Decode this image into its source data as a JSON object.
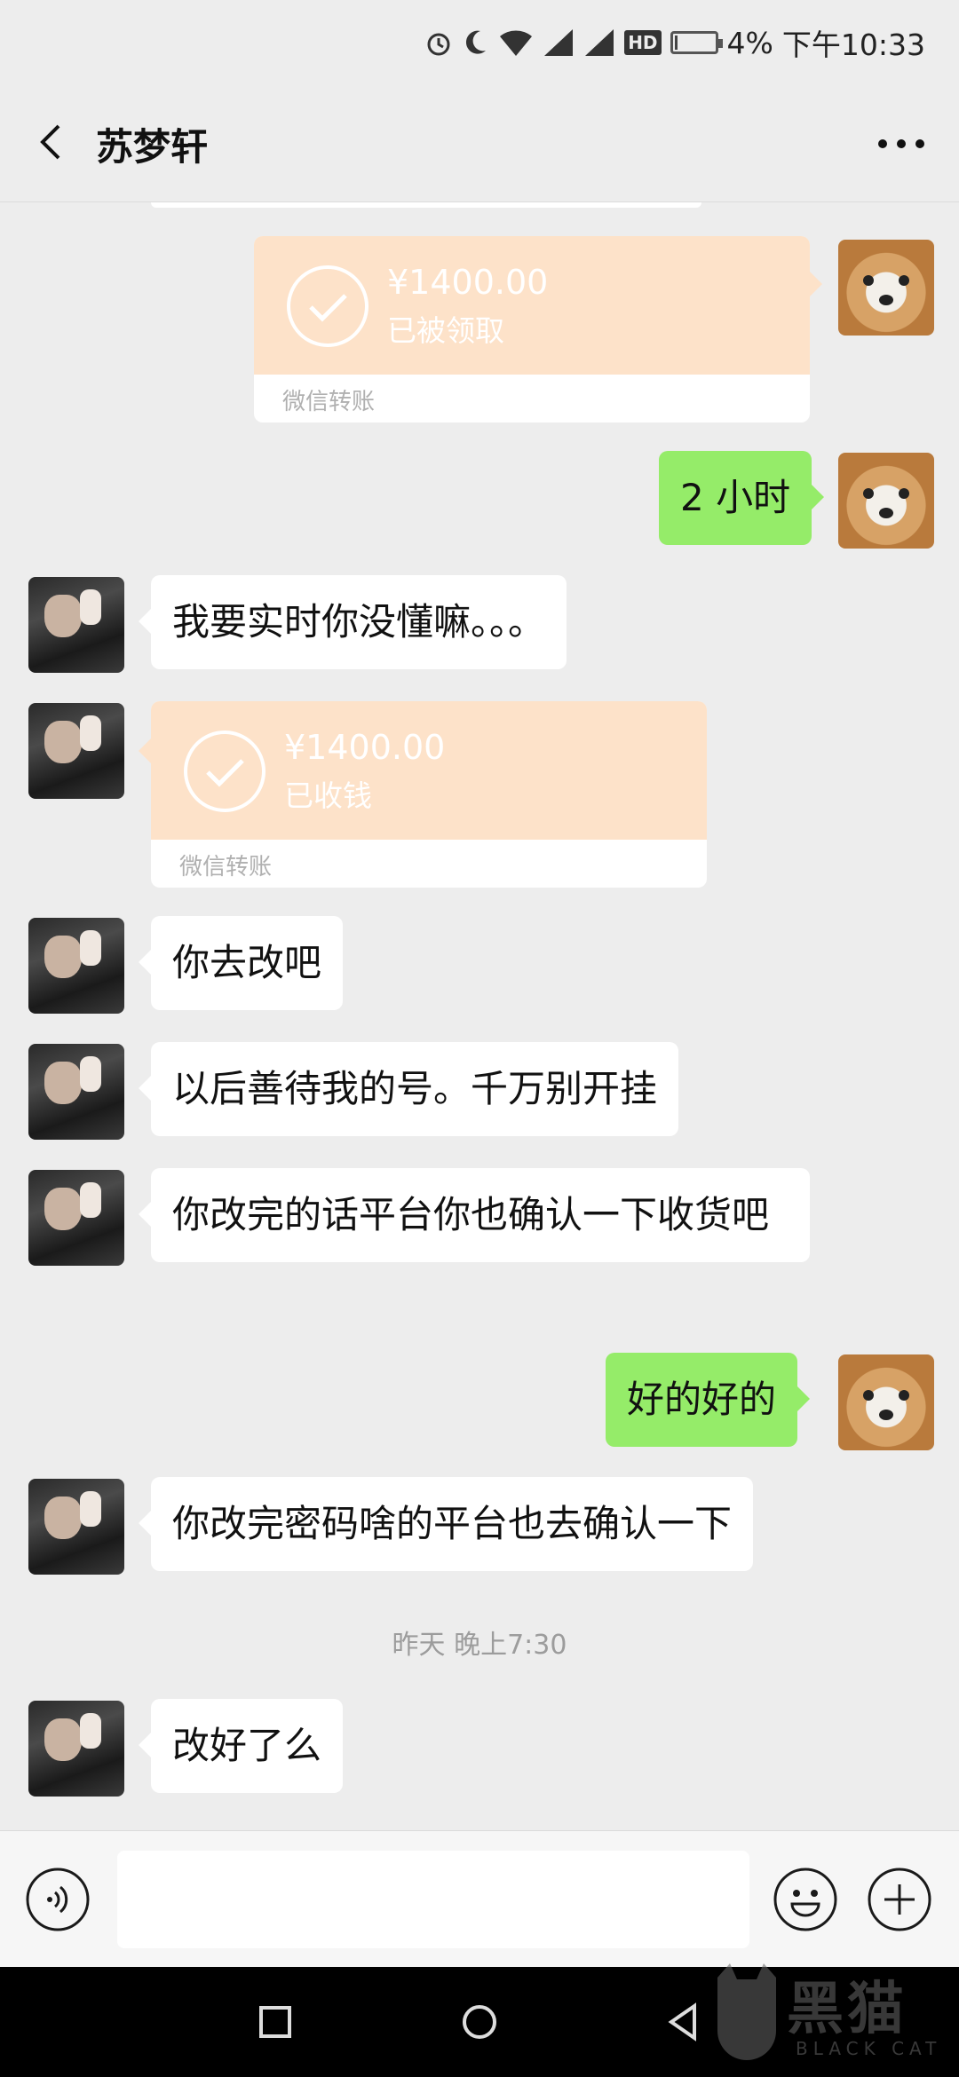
{
  "status_bar": {
    "battery_percent": "4%",
    "time": "下午10:33",
    "icons": [
      "alarm-icon",
      "moon-icon",
      "wifi-icon",
      "signal-icon",
      "signal-icon",
      "hd-icon",
      "battery-icon"
    ],
    "hd_label": "HD"
  },
  "header": {
    "title": "苏梦轩",
    "back_icon": "chevron-left-icon",
    "more_icon": "more-icon"
  },
  "messages": {
    "transfer_1": {
      "amount": "¥1400.00",
      "status": "已被领取",
      "label": "微信转账"
    },
    "msg_2": "2 小时",
    "msg_3": "我要实时你没懂嘛。。。",
    "transfer_2": {
      "amount": "¥1400.00",
      "status": "已收钱",
      "label": "微信转账"
    },
    "msg_5": "你去改吧",
    "msg_6": "以后善待我的号。千万别开挂",
    "msg_7": "你改完的话平台你也确认一下收货吧",
    "msg_8": "好的好的",
    "msg_9": "你改完密码啥的平台也去确认一下",
    "timestamp": "昨天 晚上7:30",
    "msg_10": "改好了么"
  },
  "input_bar": {
    "voice_icon": "voice-icon",
    "emoji_icon": "emoji-icon",
    "plus_icon": "plus-icon"
  },
  "nav_bar": {
    "icons": [
      "recent-apps-icon",
      "home-icon",
      "back-icon"
    ]
  },
  "watermark": {
    "text": "黑猫",
    "sub": "BLACK CAT"
  },
  "colors": {
    "bubble_me": "#95ec69",
    "bubble_them": "#ffffff",
    "transfer": "#fde2c9",
    "background": "#ededed"
  }
}
